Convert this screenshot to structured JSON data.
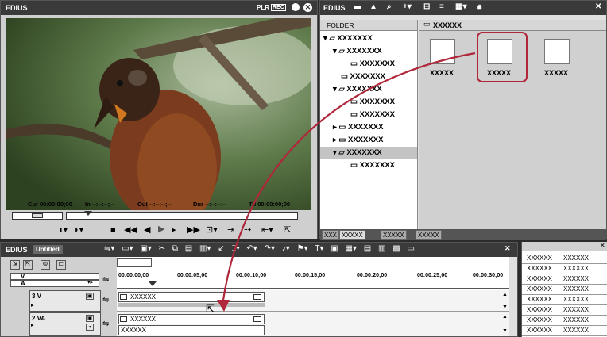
{
  "player": {
    "title": "EDIUS",
    "mode_plr": "PLR",
    "mode_rec": "REC",
    "cur": "Cur 00:00:00;00",
    "in": "In --:--:--;--",
    "out": "Out --:--:--;--",
    "dur": "Dur --:--:--;--",
    "ttl": "Ttl 00:00:00;00"
  },
  "bin": {
    "title": "EDIUS",
    "folder_header": "FOLDER",
    "clip_header": "XXXXXX",
    "tree": [
      "XXXXXXX",
      "XXXXXXX",
      "XXXXXXX",
      "XXXXXXX",
      "XXXXXXX",
      "XXXXXXX",
      "XXXXXXX",
      "XXXXXXX",
      "XXXXXXX",
      "XXXXXXX",
      "XXXXXXX"
    ],
    "thumbs": [
      "XXXXX",
      "XXXXX",
      "XXXXX"
    ],
    "tabs": [
      "XXX",
      "XXXXX",
      "XXXXX",
      "XXXXX"
    ]
  },
  "timeline": {
    "title": "EDIUS",
    "project": "Untitled",
    "track_v": "V",
    "track_a": "A",
    "ruler": [
      "00:00:00;00",
      "00:00:05;00",
      "00:00:10;00",
      "00:00:15;00",
      "00:00:20;00",
      "00:00:25;00",
      "00:00:30;00"
    ],
    "tracks": [
      {
        "name": "3 V",
        "clip": "XXXXXX"
      },
      {
        "name": "2 VA",
        "clip": "XXXXXX",
        "clip2": "XXXXXX"
      }
    ]
  },
  "info_grid": {
    "rows": [
      [
        "XXXXXX",
        "XXXXXX"
      ],
      [
        "XXXXXX",
        "XXXXXX"
      ],
      [
        "XXXXXX",
        "XXXXXX"
      ],
      [
        "XXXXXX",
        "XXXXXX"
      ],
      [
        "XXXXXX",
        "XXXXXX"
      ],
      [
        "XXXXXX",
        "XXXXXX"
      ],
      [
        "XXXXXX",
        "XXXXXX"
      ],
      [
        "XXXXXX",
        "XXXXXX"
      ]
    ]
  }
}
